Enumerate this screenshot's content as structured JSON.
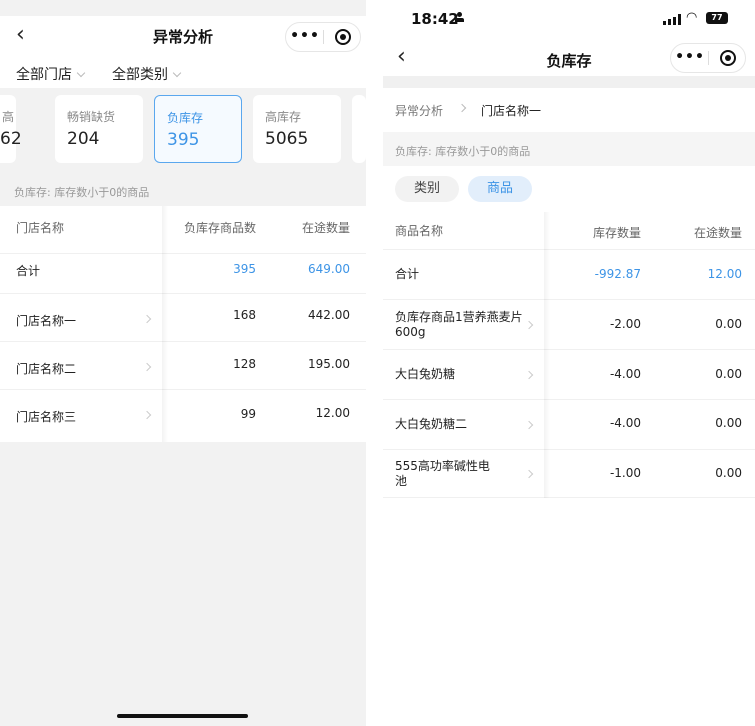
{
  "left": {
    "nav": {
      "back_glyph": "‹",
      "title": "异常分析"
    },
    "capsule": {
      "menu_icon": "more-dots-icon",
      "close_icon": "target-icon"
    },
    "filters": [
      {
        "label": "全部门店"
      },
      {
        "label": "全部类别"
      }
    ],
    "cards": [
      {
        "label": "高",
        "value": "62"
      },
      {
        "label": "畅销缺货",
        "value": "204"
      },
      {
        "label": "负库存",
        "value": "395"
      },
      {
        "label": "高库存",
        "value": "5065"
      },
      {
        "label": "",
        "value": ""
      }
    ],
    "description": "负库存: 库存数小于0的商品",
    "table": {
      "headers": [
        "门店名称",
        "负库存商品数",
        "在途数量"
      ],
      "total": {
        "name": "合计",
        "count": "395",
        "transit": "649.00"
      },
      "rows": [
        {
          "name": "门店名称一",
          "count": "168",
          "transit": "442.00"
        },
        {
          "name": "门店名称二",
          "count": "128",
          "transit": "195.00"
        },
        {
          "name": "门店名称三",
          "count": "99",
          "transit": "12.00"
        }
      ]
    }
  },
  "right": {
    "status": {
      "time": "18:42",
      "battery": "77"
    },
    "nav": {
      "back_glyph": "‹",
      "title": "负库存"
    },
    "breadcrumb": [
      "异常分析",
      "门店名称一"
    ],
    "description": "负库存: 库存数小于0的商品",
    "segments": [
      "类别",
      "商品"
    ],
    "table": {
      "headers": [
        "商品名称",
        "库存数量",
        "在途数量"
      ],
      "total": {
        "name": "合计",
        "stock": "-992.87",
        "transit": "12.00"
      },
      "rows": [
        {
          "name": "负库存商品1营养燕麦片600g",
          "stock": "-2.00",
          "transit": "0.00"
        },
        {
          "name": "大白兔奶糖",
          "stock": "-4.00",
          "transit": "0.00"
        },
        {
          "name": "大白兔奶糖二",
          "stock": "-4.00",
          "transit": "0.00"
        },
        {
          "name": "555高功率碱性电池",
          "stock": "-1.00",
          "transit": "0.00"
        }
      ]
    }
  },
  "colors": {
    "accent": "#3d94e6",
    "background": "#f2f2f2",
    "text": "#222222"
  }
}
